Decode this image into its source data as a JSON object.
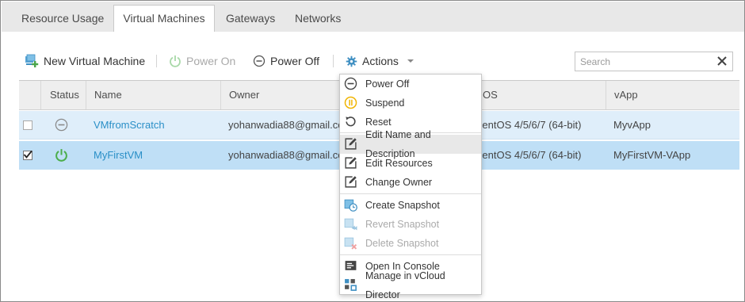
{
  "tabs": [
    {
      "label": "Resource Usage"
    },
    {
      "label": "Virtual Machines"
    },
    {
      "label": "Gateways"
    },
    {
      "label": "Networks"
    }
  ],
  "toolbar": {
    "new_vm": "New Virtual Machine",
    "power_on": "Power On",
    "power_off": "Power Off",
    "actions": "Actions"
  },
  "search": {
    "placeholder": "Search",
    "value": ""
  },
  "table": {
    "headers": {
      "status": "Status",
      "name": "Name",
      "owner": "Owner",
      "os": "OS",
      "vapp": "vApp"
    },
    "rows": [
      {
        "checked": false,
        "status": "off",
        "name": "VMfromScratch",
        "owner": "yohanwadia88@gmail.com",
        "os": "CentOS 4/5/6/7 (64-bit)",
        "vapp": "MyvApp"
      },
      {
        "checked": true,
        "status": "on",
        "name": "MyFirstVM",
        "owner": "yohanwadia88@gmail.com",
        "os": "CentOS 4/5/6/7 (64-bit)",
        "vapp": "MyFirstVM-VApp"
      }
    ]
  },
  "menu": {
    "items": [
      {
        "label": "Power Off",
        "icon": "power-off-icon",
        "enabled": true
      },
      {
        "label": "Suspend",
        "icon": "suspend-icon",
        "enabled": true
      },
      {
        "label": "Reset",
        "icon": "reset-icon",
        "enabled": true
      },
      {
        "label": "Edit Name and Description",
        "icon": "edit-icon",
        "enabled": true
      },
      {
        "label": "Edit Resources",
        "icon": "edit-icon",
        "enabled": true
      },
      {
        "label": "Change Owner",
        "icon": "edit-icon",
        "enabled": true
      },
      {
        "label": "Create Snapshot",
        "icon": "snapshot-create-icon",
        "enabled": true
      },
      {
        "label": "Revert Snapshot",
        "icon": "snapshot-revert-icon",
        "enabled": false
      },
      {
        "label": "Delete Snapshot",
        "icon": "snapshot-delete-icon",
        "enabled": false
      },
      {
        "label": "Open In Console",
        "icon": "console-icon",
        "enabled": true
      },
      {
        "label": "Manage in vCloud Director",
        "icon": "vcloud-icon",
        "enabled": true
      }
    ]
  },
  "colors": {
    "accent_blue": "#2a8fc7",
    "power_green": "#5cb85c",
    "suspend_yellow": "#f0b400",
    "delete_red": "#e05555",
    "row_selected": "#bfdff6",
    "row_hover": "#dfeefa"
  }
}
